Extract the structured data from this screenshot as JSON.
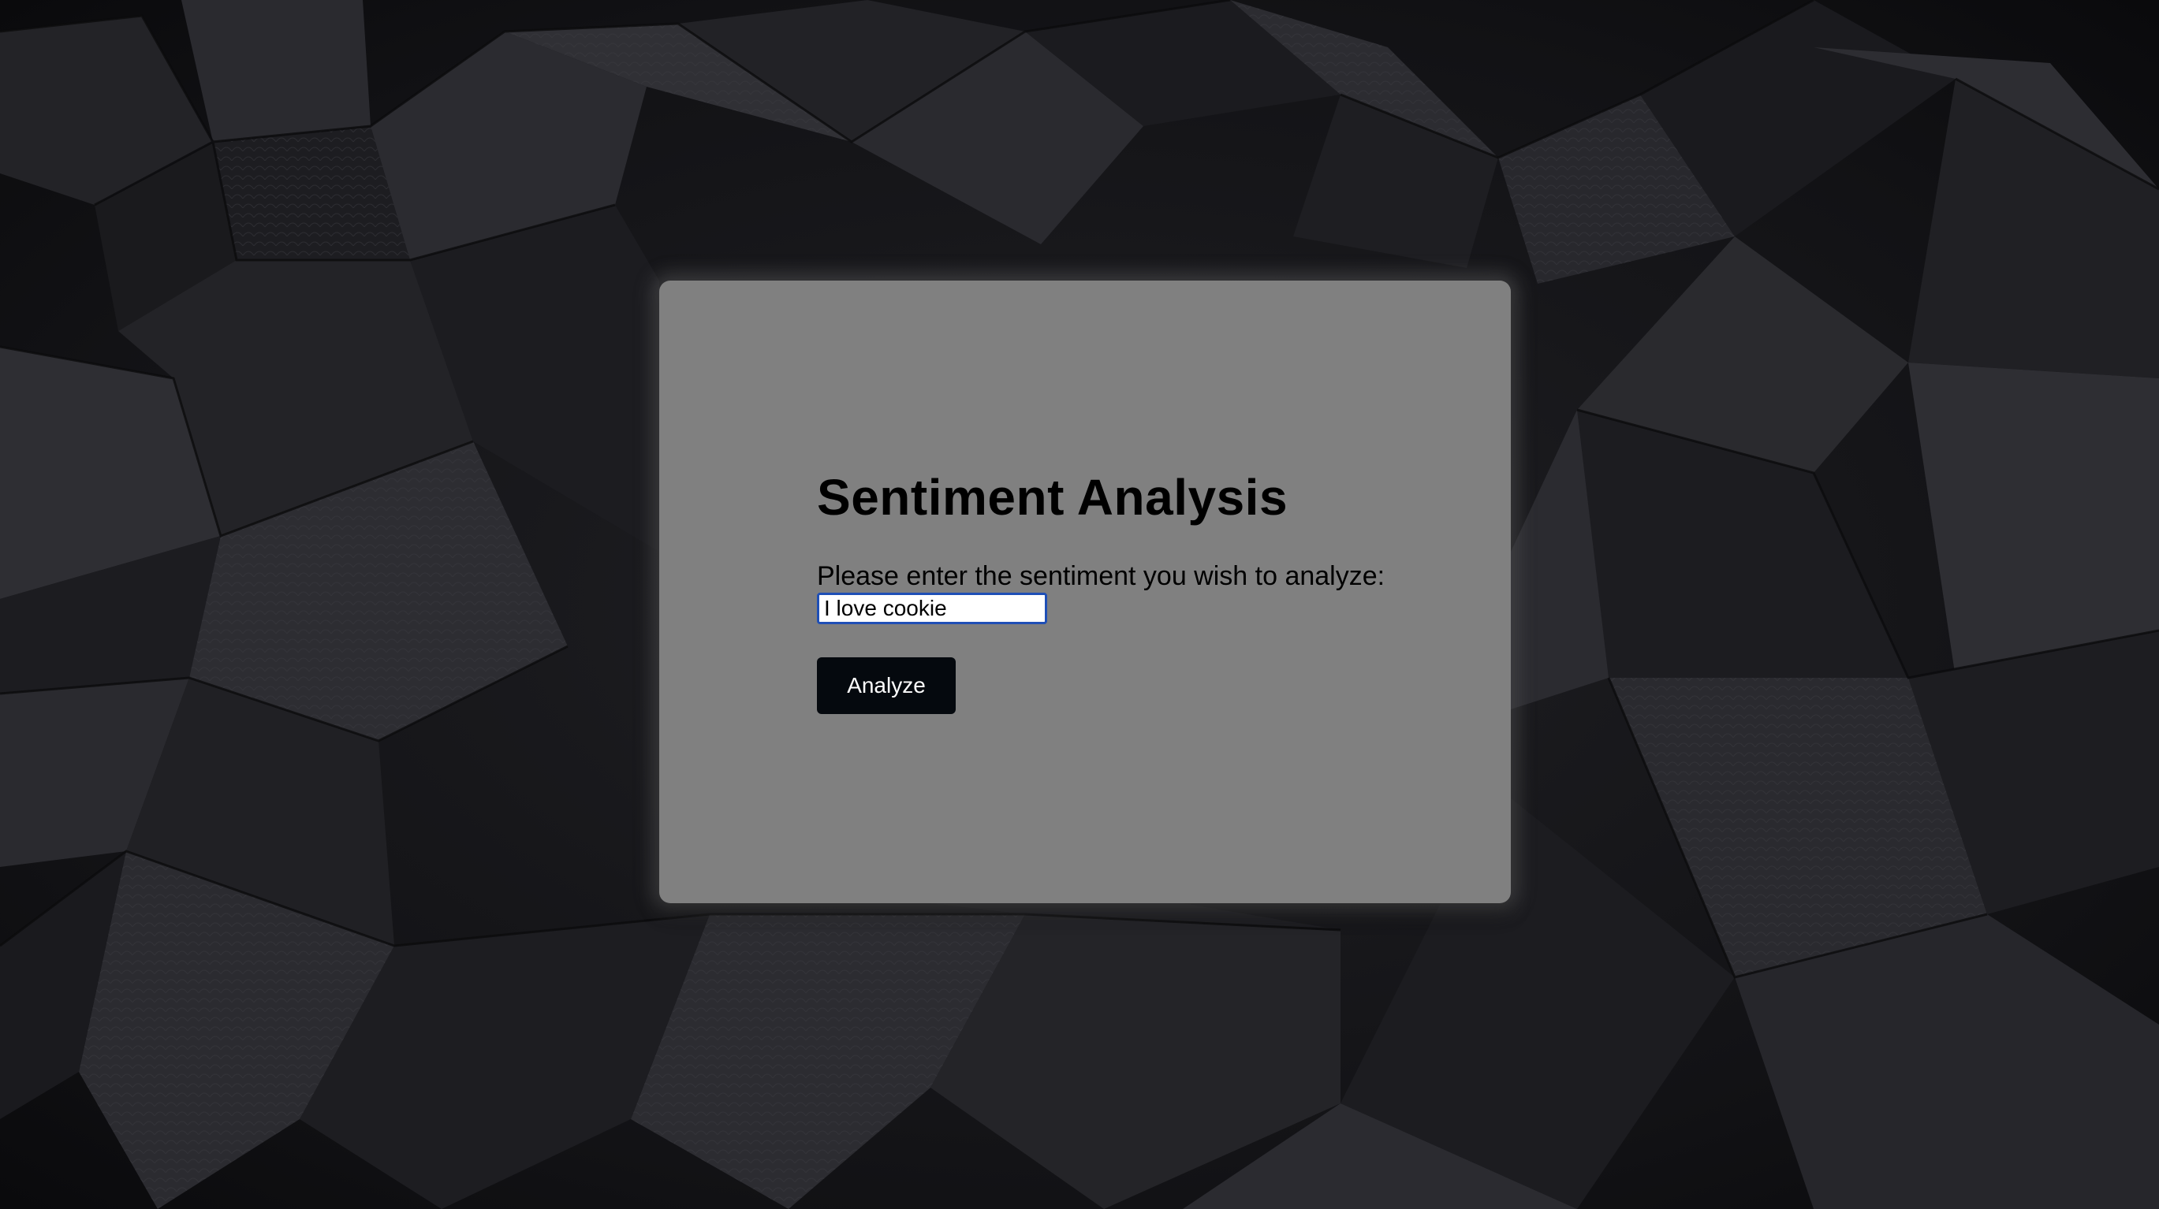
{
  "page": {
    "title": "Sentiment Analysis",
    "prompt": "Please enter the sentiment you wish to analyze:",
    "input_value": "I love cookie",
    "button_label": "Analyze"
  },
  "colors": {
    "card_background": "#808080",
    "button_background": "#05090e",
    "button_text": "#ffffff",
    "input_focus_border": "#1f4fb6",
    "page_background": "#141417"
  }
}
